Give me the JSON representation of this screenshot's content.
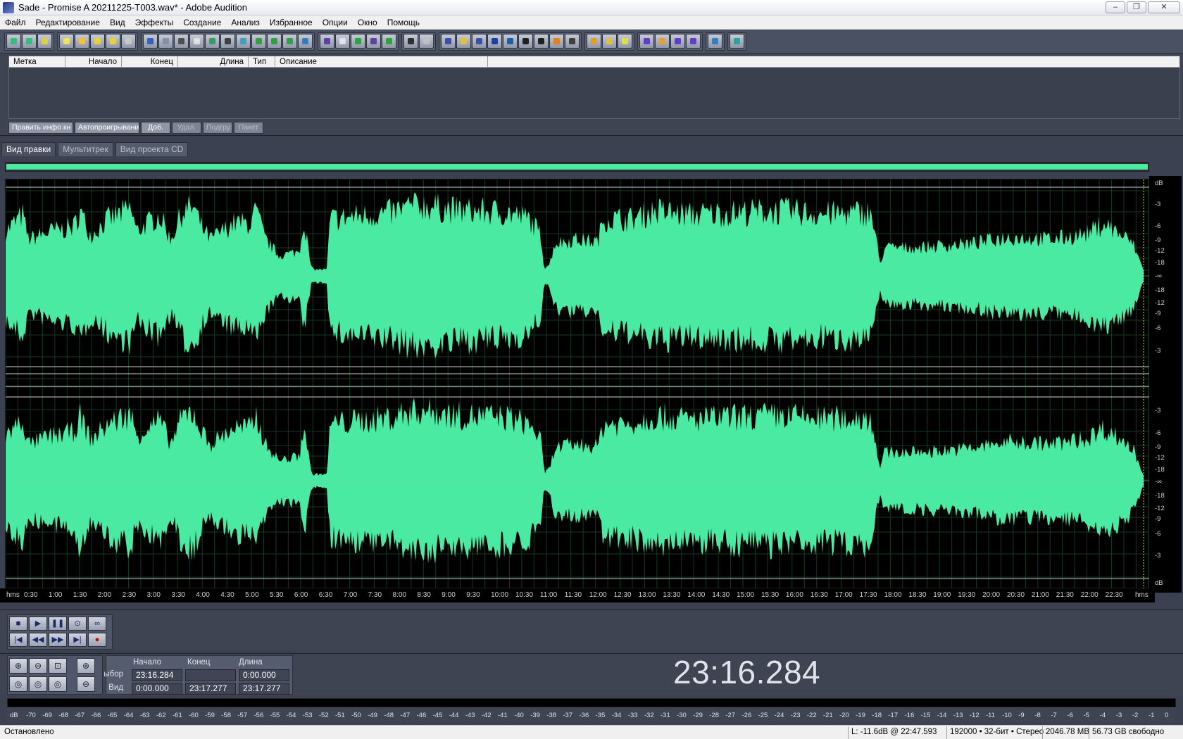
{
  "window": {
    "title": "Sade - Promise  A 20211225-T003.wav* - Adobe Audition",
    "controls": [
      "–",
      "❐",
      "✕"
    ]
  },
  "menu": [
    "Файл",
    "Редактирование",
    "Вид",
    "Эффекты",
    "Создание",
    "Анализ",
    "Избранное",
    "Опции",
    "Окно",
    "Помощь"
  ],
  "cue_list": {
    "columns": [
      "Метка",
      "Начало",
      "Конец",
      "Длина",
      "Тип",
      "Описание"
    ],
    "buttons": [
      "Править инфо кн",
      "Автопроигрывани",
      "Доб.",
      "Удал.",
      "Подгруз",
      "Пакет"
    ]
  },
  "tabs": [
    "Вид правки",
    "Мультитрек",
    "Вид проекта CD"
  ],
  "colors": {
    "waveform": "#4aeaa3",
    "background": "#000000",
    "panel": "#3e4452"
  },
  "db_scale_top": [
    "dB",
    "-3",
    "-6",
    "-9",
    "-12",
    "-18",
    "-∞",
    "-18",
    "-12",
    "-9",
    "-6",
    "-3"
  ],
  "db_scale_bottom": [
    "-3",
    "-6",
    "-9",
    "-12",
    "-18",
    "-∞",
    "-18",
    "-12",
    "-9",
    "-6",
    "-3",
    "dB"
  ],
  "timeline": [
    "hms",
    "0:30",
    "1:00",
    "1:30",
    "2:00",
    "2:30",
    "3:00",
    "3:30",
    "4:00",
    "4:30",
    "5:00",
    "5:30",
    "6:00",
    "6:30",
    "7:00",
    "7:30",
    "8:00",
    "8:30",
    "9:00",
    "9:30",
    "10:00",
    "10:30",
    "11:00",
    "11:30",
    "12:00",
    "12:30",
    "13:00",
    "13:30",
    "14:00",
    "14:30",
    "15:00",
    "15:30",
    "16:00",
    "16:30",
    "17:00",
    "17:30",
    "18:00",
    "18:30",
    "19:00",
    "19:30",
    "20:00",
    "20:30",
    "21:00",
    "21:30",
    "22:00",
    "22:30",
    "hms"
  ],
  "selection": {
    "headers": [
      "Начало",
      "Конец",
      "Длина"
    ],
    "row_select": {
      "label": "ыбор",
      "start": "23:16.284",
      "end": "",
      "length": "0:00.000"
    },
    "row_view": {
      "label": "Вид",
      "start": "0:00.000",
      "end": "23:17.277",
      "length": "23:17.277"
    }
  },
  "big_time": "23:16.284",
  "meter_ticks": [
    "dB",
    "-70",
    "-69",
    "-68",
    "-67",
    "-66",
    "-65",
    "-64",
    "-63",
    "-62",
    "-61",
    "-60",
    "-59",
    "-58",
    "-57",
    "-56",
    "-55",
    "-54",
    "-53",
    "-52",
    "-51",
    "-50",
    "-49",
    "-48",
    "-47",
    "-46",
    "-45",
    "-44",
    "-43",
    "-42",
    "-41",
    "-40",
    "-39",
    "-38",
    "-37",
    "-36",
    "-35",
    "-34",
    "-33",
    "-32",
    "-31",
    "-30",
    "-29",
    "-28",
    "-27",
    "-26",
    "-25",
    "-24",
    "-23",
    "-22",
    "-21",
    "-20",
    "-19",
    "-18",
    "-17",
    "-16",
    "-15",
    "-14",
    "-13",
    "-12",
    "-11",
    "-10",
    "-9",
    "-8",
    "-7",
    "-6",
    "-5",
    "-4",
    "-3",
    "-2",
    "-1",
    "0"
  ],
  "status": {
    "state": "Остановлено",
    "level": "L: -11.6dB @  22:47.593",
    "format": "192000 • 32-бит • Стерео",
    "size": "2046.78 MB",
    "free": "56.73 GB свободно"
  }
}
